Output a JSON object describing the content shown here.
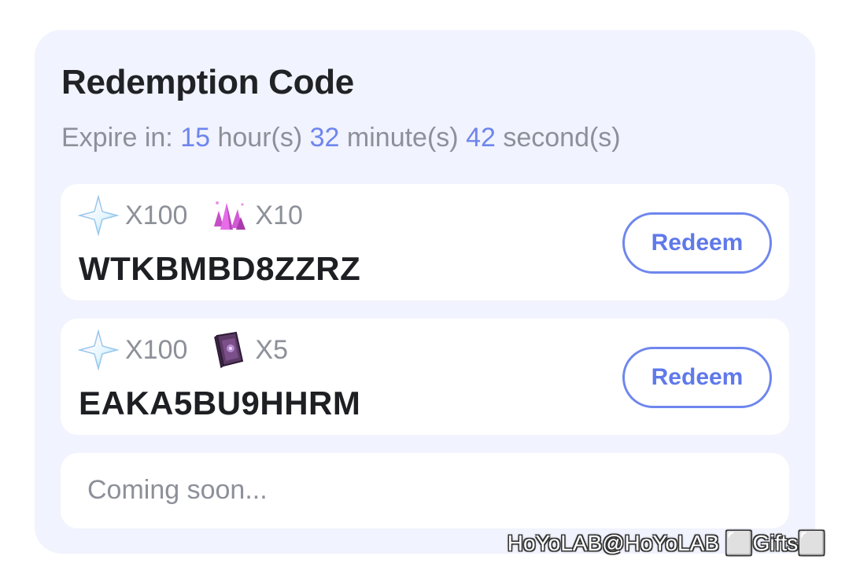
{
  "header": {
    "title": "Redemption Code",
    "expire_prefix": "Expire in:",
    "hours": "15",
    "hours_unit": "hour(s)",
    "minutes": "32",
    "minutes_unit": "minute(s)",
    "seconds": "42",
    "seconds_unit": "second(s)"
  },
  "codes": [
    {
      "rewards": [
        {
          "icon": "stellar-jade-icon",
          "qty": "X100"
        },
        {
          "icon": "crystal-icon",
          "qty": "X10"
        }
      ],
      "code": "WTKBMBD8ZZRZ",
      "button_label": "Redeem"
    },
    {
      "rewards": [
        {
          "icon": "stellar-jade-icon",
          "qty": "X100"
        },
        {
          "icon": "book-icon",
          "qty": "X5"
        }
      ],
      "code": "EAKA5BU9HHRM",
      "button_label": "Redeem"
    }
  ],
  "coming_soon": "Coming soon...",
  "watermark": "HoYoLAB@HoYoLAB ⬜Gifts⬜",
  "colors": {
    "card_bg": "#f1f3fe",
    "accent": "#6e86ee",
    "muted_text": "#8d9099",
    "code_text": "#1e1f23"
  }
}
